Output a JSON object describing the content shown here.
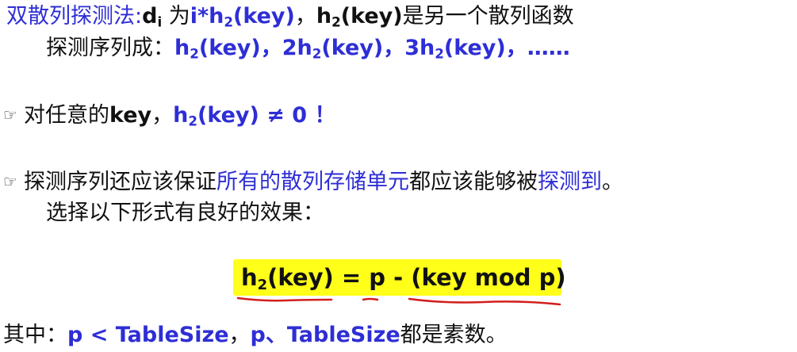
{
  "line1": {
    "title": "双散列探测法:",
    "d": "d",
    "d_sub": "i",
    "mid": " 为",
    "formula": "i*h",
    "formula_sub": "2",
    "formula_end": "(key)",
    "comma": "，",
    "h2": "h",
    "h2_sub": "2",
    "h2_end": "(key)",
    "tail": "是另一个散列函数"
  },
  "line2": {
    "lead": "探测序列成：",
    "t1a": "h",
    "t1sub": "2",
    "t1b": "(key)",
    "c1": "，",
    "t2a": "2h",
    "t2sub": "2",
    "t2b": "(key)",
    "c2": "，",
    "t3a": "3h",
    "t3sub": "2",
    "t3b": "(key)",
    "c3": "，",
    "dots": "……"
  },
  "bullet1": {
    "icon": "pointing-hand-icon",
    "text1": "对任意的",
    "key": "key",
    "comma": "，",
    "f1": "h",
    "fsub": "2",
    "f2": "(key) ≠ 0 ！"
  },
  "bullet2": {
    "icon": "pointing-hand-icon",
    "text1": "探测序列还应该保证",
    "blue1": "所有的散列存储单元",
    "text2": "都应该能够被",
    "blue2": "探测到",
    "end": "。",
    "line2": "选择以下形式有良好的效果："
  },
  "formula": {
    "a": "h",
    "sub": "2",
    "b": "(key) = p - (key mod p)"
  },
  "footer": {
    "lead": "其中：",
    "b1": "p < TableSize",
    "comma": "，",
    "b2": "p、TableSize",
    "tail": "都是素数。"
  },
  "colors": {
    "blue": "#2e2ed6",
    "highlight": "#ffff1a",
    "underline": "#d21e1e"
  }
}
